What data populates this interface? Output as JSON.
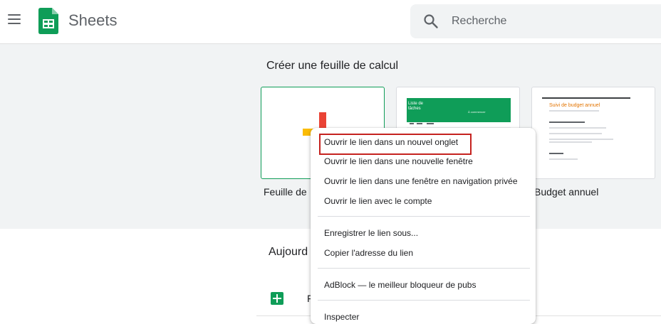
{
  "header": {
    "app_title": "Sheets",
    "search_placeholder": "Recherche",
    "menu_icon": "hamburger-menu-icon",
    "logo_icon": "google-sheets-logo-icon",
    "search_icon": "magnifier-icon"
  },
  "gallery": {
    "title": "Créer une feuille de calcul",
    "templates": [
      {
        "label": "Feuille de calcul vierge",
        "visible_label": "Feuille de"
      },
      {
        "label": "Liste de tâches",
        "thumb_title": "Liste de tâches",
        "thumb_right": "À commencer"
      },
      {
        "label": "Budget annuel",
        "thumb_title": "Suivi de budget annuel"
      }
    ]
  },
  "recent": {
    "title": "Aujourd'hui",
    "visible_title": "Aujourd",
    "file_initial": "F"
  },
  "context_menu": {
    "items": [
      "Ouvrir le lien dans un nouvel onglet",
      "Ouvrir le lien dans une nouvelle fenêtre",
      "Ouvrir le lien dans une fenêtre en navigation privée",
      "Ouvrir le lien avec le compte",
      "Enregistrer le lien sous...",
      "Copier l'adresse du lien",
      "AdBlock — le meilleur bloqueur de pubs",
      "Inspecter"
    ],
    "highlighted_index": 0
  },
  "colors": {
    "brand_green": "#0f9d58",
    "highlight_border": "#c5221f",
    "gallery_bg": "#f1f3f4",
    "budget_title": "#e37400"
  }
}
